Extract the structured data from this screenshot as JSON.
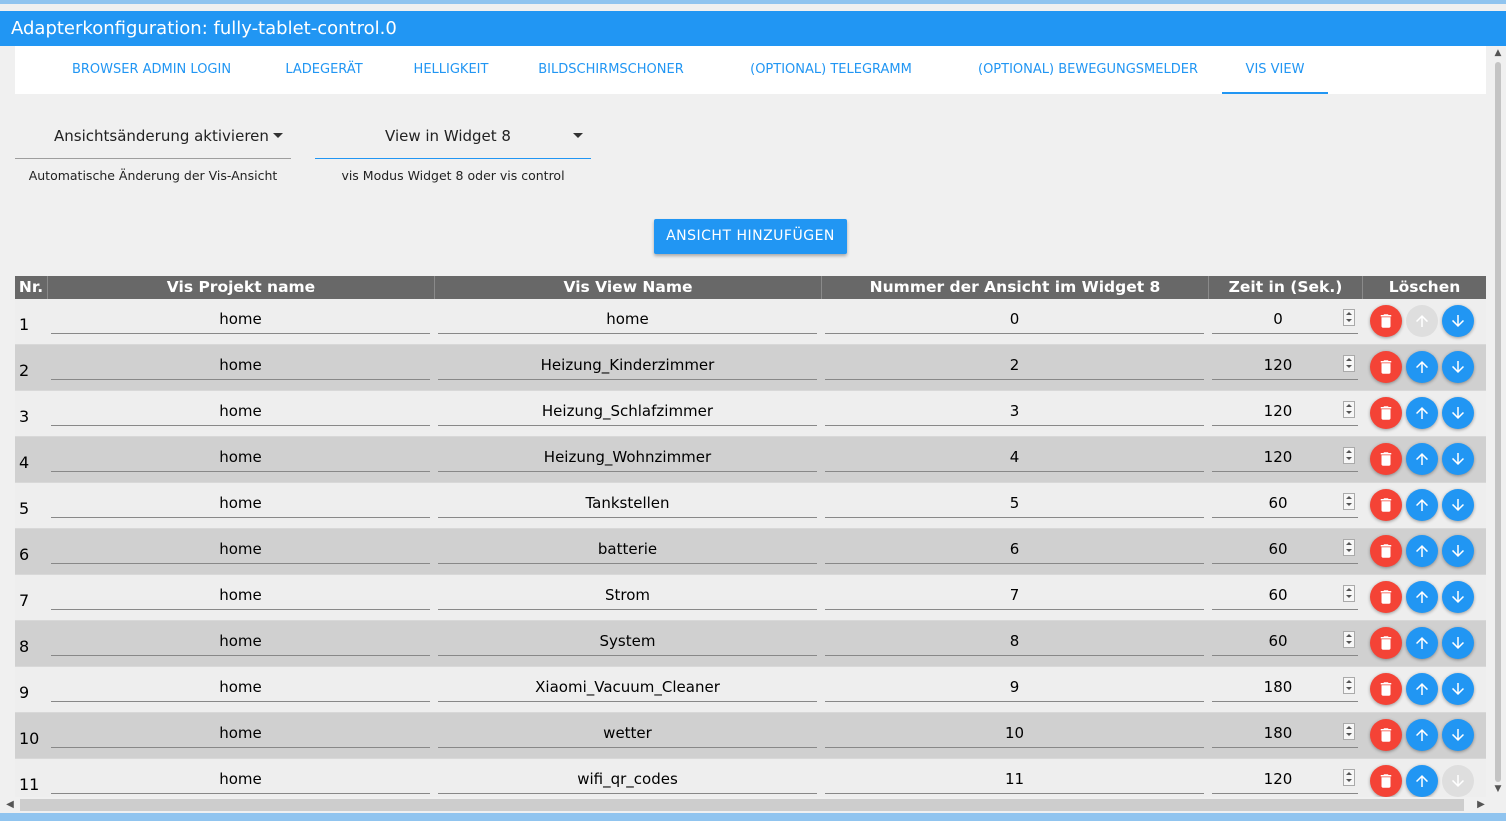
{
  "window": {
    "title": "Adapterkonfiguration: fully-tablet-control.0"
  },
  "tabs": [
    {
      "label": "BROWSER ADMIN LOGIN",
      "active": false
    },
    {
      "label": "LADEGERÄT",
      "active": false
    },
    {
      "label": "HELLIGKEIT",
      "active": false
    },
    {
      "label": "BILDSCHIRMSCHONER",
      "active": false
    },
    {
      "label": "(OPTIONAL) TELEGRAMM",
      "active": false
    },
    {
      "label": "(OPTIONAL) BEWEGUNGSMELDER",
      "active": false
    },
    {
      "label": "VIS VIEW",
      "active": true
    }
  ],
  "settings": {
    "view_change": {
      "value": "Ansichtsänderung aktivieren",
      "helper": "Automatische Änderung der Vis-Ansicht"
    },
    "view_mode": {
      "value": "View in Widget 8",
      "helper": "vis Modus Widget 8 oder vis control"
    }
  },
  "add_button": {
    "label": "ANSICHT HINZUFÜGEN"
  },
  "table": {
    "headers": {
      "nr": "Nr.",
      "project": "Vis Projekt name",
      "view": "Vis View Name",
      "number": "Nummer der Ansicht im Widget 8",
      "time": "Zeit in (Sek.)",
      "delete": "Löschen"
    },
    "rows": [
      {
        "nr": "1",
        "project": "home",
        "view": "home",
        "number": "0",
        "time": "0",
        "up_disabled": true,
        "down_disabled": false
      },
      {
        "nr": "2",
        "project": "home",
        "view": "Heizung_Kinderzimmer",
        "number": "2",
        "time": "120",
        "up_disabled": false,
        "down_disabled": false
      },
      {
        "nr": "3",
        "project": "home",
        "view": "Heizung_Schlafzimmer",
        "number": "3",
        "time": "120",
        "up_disabled": false,
        "down_disabled": false
      },
      {
        "nr": "4",
        "project": "home",
        "view": "Heizung_Wohnzimmer",
        "number": "4",
        "time": "120",
        "up_disabled": false,
        "down_disabled": false
      },
      {
        "nr": "5",
        "project": "home",
        "view": "Tankstellen",
        "number": "5",
        "time": "60",
        "up_disabled": false,
        "down_disabled": false
      },
      {
        "nr": "6",
        "project": "home",
        "view": "batterie",
        "number": "6",
        "time": "60",
        "up_disabled": false,
        "down_disabled": false
      },
      {
        "nr": "7",
        "project": "home",
        "view": "Strom",
        "number": "7",
        "time": "60",
        "up_disabled": false,
        "down_disabled": false
      },
      {
        "nr": "8",
        "project": "home",
        "view": "System",
        "number": "8",
        "time": "60",
        "up_disabled": false,
        "down_disabled": false
      },
      {
        "nr": "9",
        "project": "home",
        "view": "Xiaomi_Vacuum_Cleaner",
        "number": "9",
        "time": "180",
        "up_disabled": false,
        "down_disabled": false
      },
      {
        "nr": "10",
        "project": "home",
        "view": "wetter",
        "number": "10",
        "time": "180",
        "up_disabled": false,
        "down_disabled": false
      },
      {
        "nr": "11",
        "project": "home",
        "view": "wifi_qr_codes",
        "number": "11",
        "time": "120",
        "up_disabled": false,
        "down_disabled": true
      }
    ]
  },
  "icons": {
    "delete": "trash-icon",
    "up": "arrow-up-icon",
    "down": "arrow-down-icon",
    "dropdown": "caret-down-icon"
  },
  "colors": {
    "primary": "#2196f3",
    "danger": "#f44336",
    "header": "#686868",
    "disabled": "#dedede"
  }
}
